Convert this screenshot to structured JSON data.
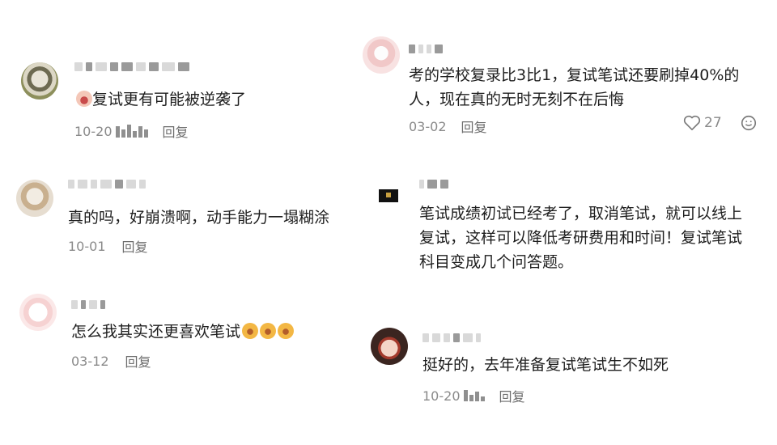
{
  "comments": [
    {
      "body": "复试更有可能被逆袭了",
      "date": "10-20",
      "reply": "回复"
    },
    {
      "body": "真的吗，好崩溃啊，动手能力一塌糊涂",
      "date": "10-01",
      "reply": "回复"
    },
    {
      "body": "怎么我其实还更喜欢笔试",
      "date": "03-12",
      "reply": "回复"
    },
    {
      "body_lines": [
        "考的学校复录比3比1，复试笔试还要刷掉40%的",
        "人，现在真的无时无刻不在后悔"
      ],
      "date": "03-02",
      "reply": "回复",
      "likes": "27"
    },
    {
      "body_lines": [
        "笔试成绩初试已经考了，取消笔试，就可以线上",
        "复试，这样可以降低考研费用和时间！复试笔试",
        "科目变成几个问答题。"
      ]
    },
    {
      "body": "挺好的，去年准备复试笔试生不如死",
      "date": "10-20",
      "reply": "回复"
    }
  ],
  "icons": {
    "heart": "heart-icon",
    "comment": "comment-icon",
    "emoji_angry": "angry-face-emoji",
    "emoji_scared": "scared-face-emoji"
  },
  "colors": {
    "text": "#1e1e1e",
    "meta": "#8a8a8a",
    "placeholder": "#d9d9d9"
  }
}
